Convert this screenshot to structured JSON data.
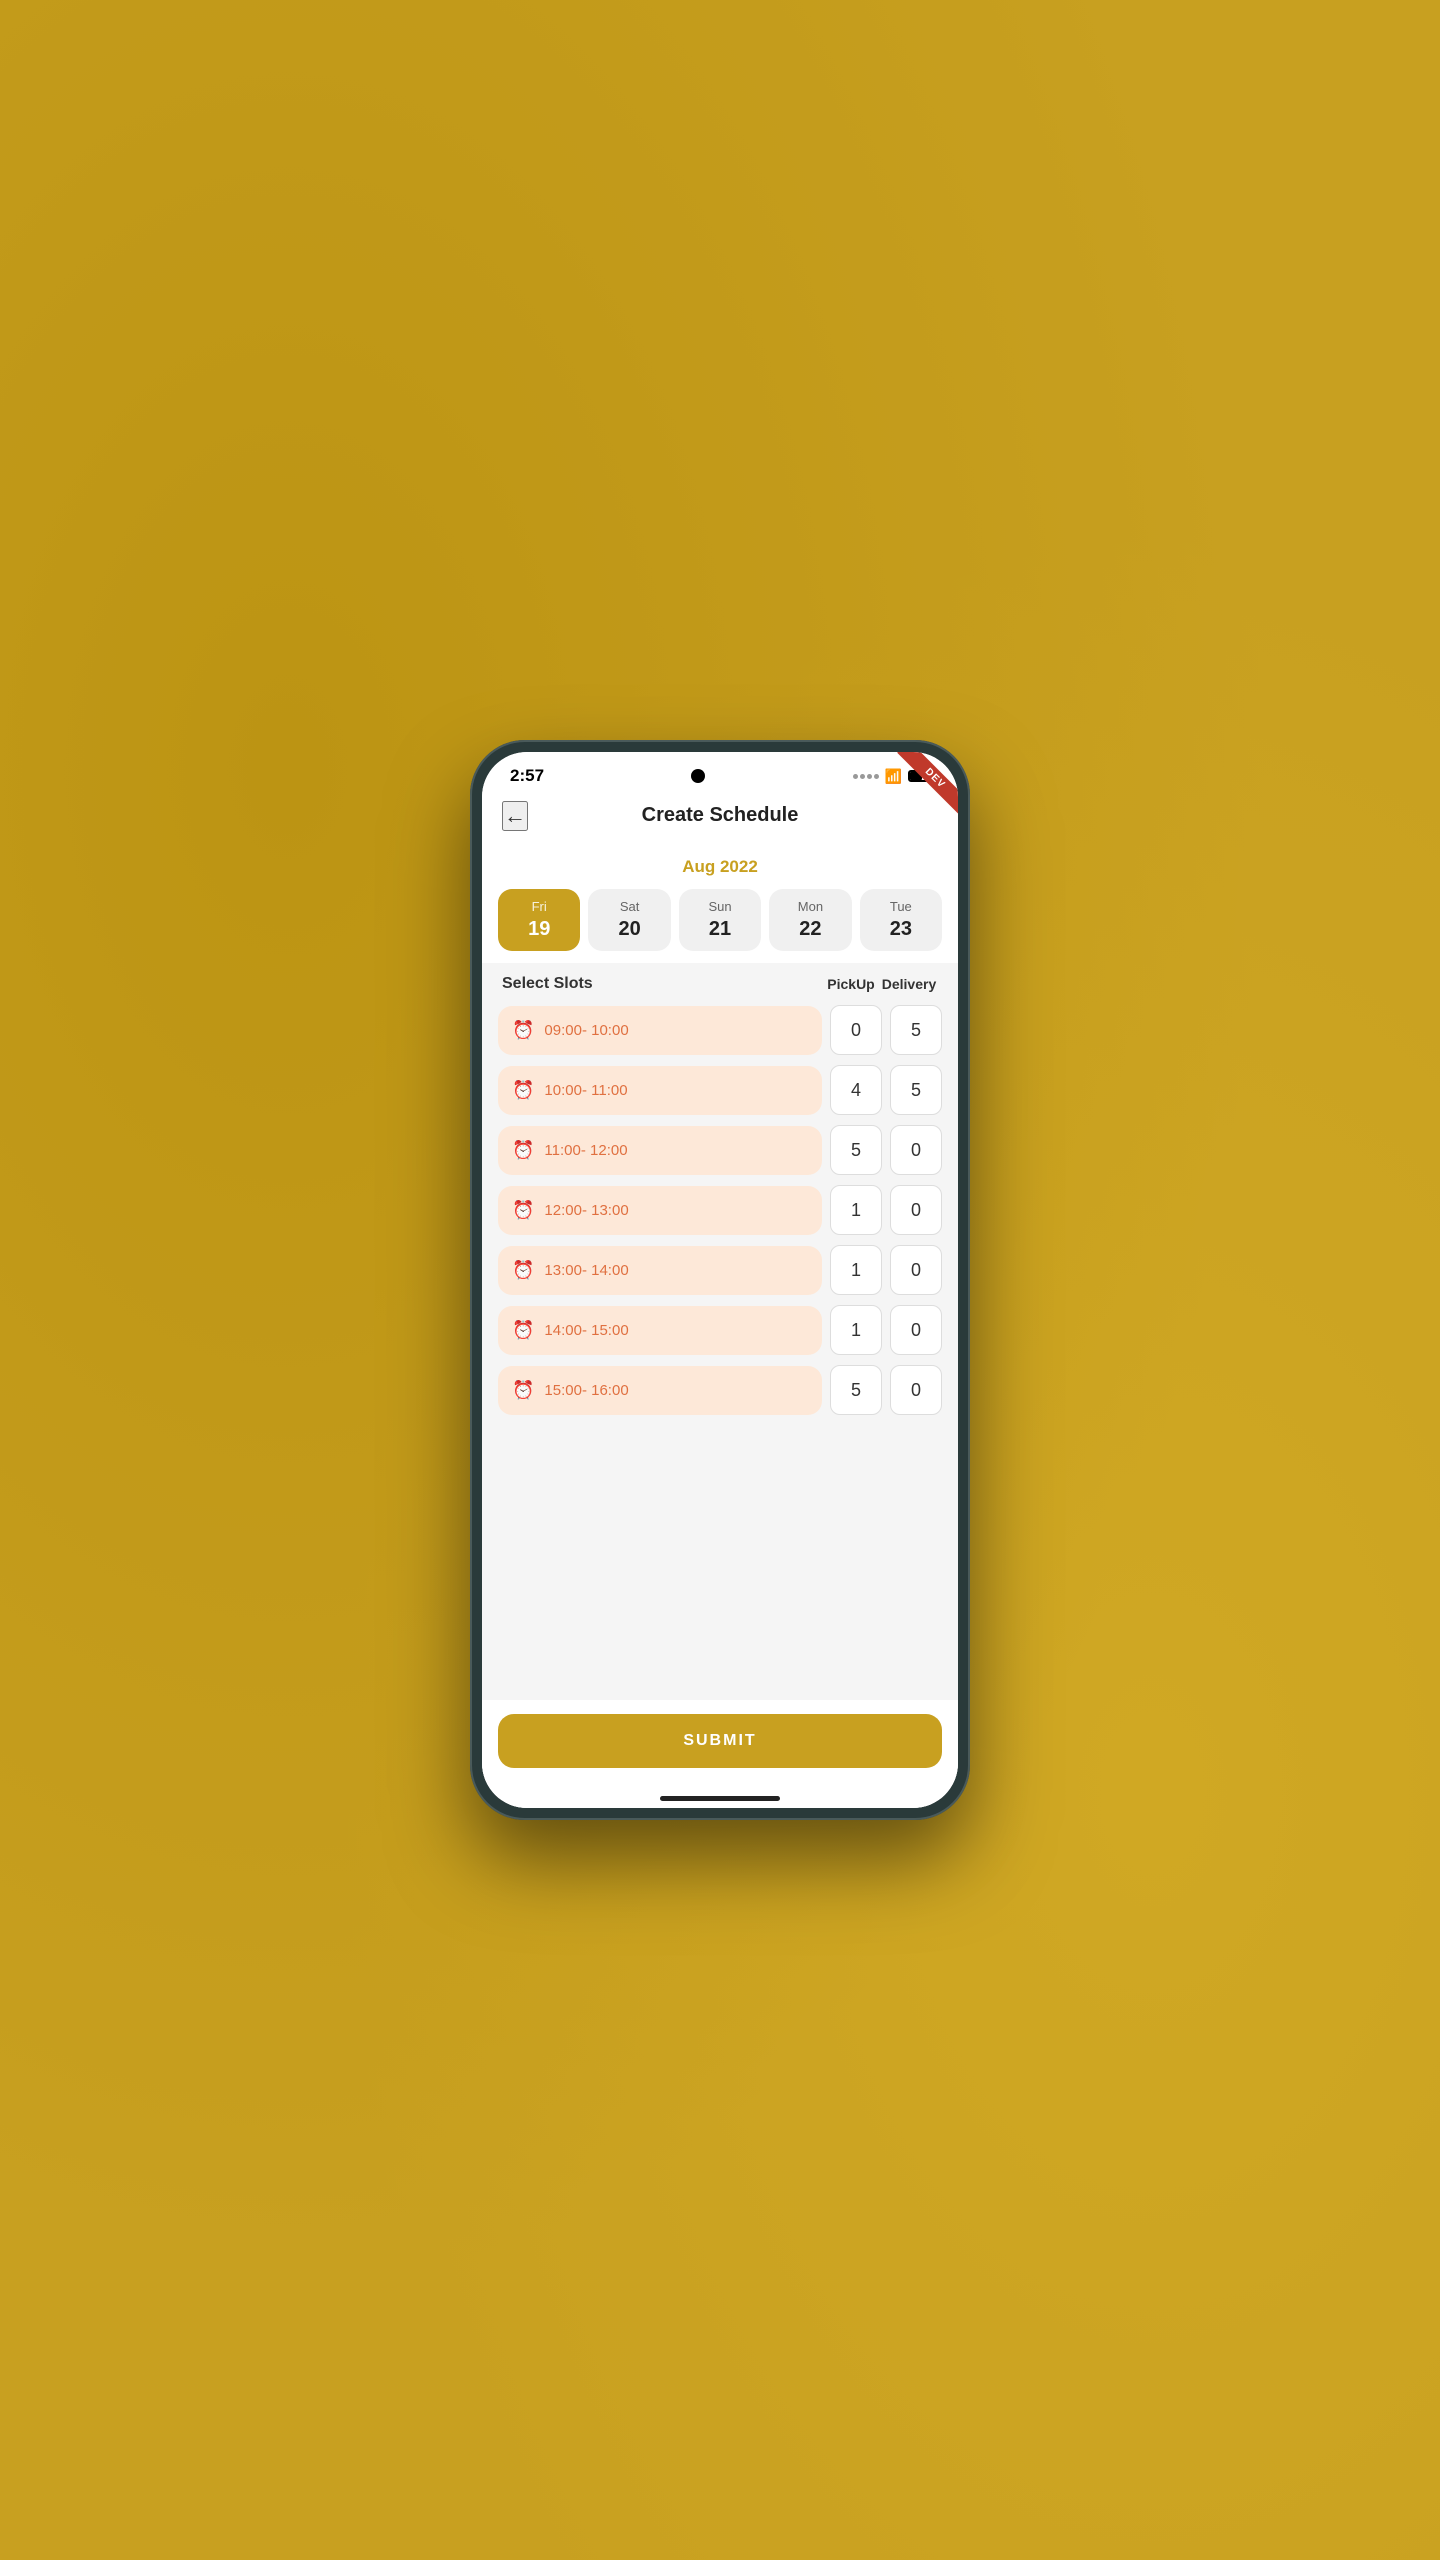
{
  "background": {
    "color": "#c8a020"
  },
  "status_bar": {
    "time": "2:57",
    "dev_badge": "DEV"
  },
  "header": {
    "back_label": "←",
    "title": "Create Schedule"
  },
  "calendar": {
    "month_label": "Aug 2022",
    "days": [
      {
        "name": "Fri",
        "number": "19",
        "active": true
      },
      {
        "name": "Sat",
        "number": "20",
        "active": false
      },
      {
        "name": "Sun",
        "number": "21",
        "active": false
      },
      {
        "name": "Mon",
        "number": "22",
        "active": false
      },
      {
        "name": "Tue",
        "number": "23",
        "active": false
      }
    ]
  },
  "slots": {
    "header_title": "Select Slots",
    "header_pickup": "PickUp",
    "header_delivery": "Delivery",
    "rows": [
      {
        "time": "09:00- 10:00",
        "pickup": "0",
        "delivery": "5"
      },
      {
        "time": "10:00- 11:00",
        "pickup": "4",
        "delivery": "5"
      },
      {
        "time": "11:00- 12:00",
        "pickup": "5",
        "delivery": "0"
      },
      {
        "time": "12:00- 13:00",
        "pickup": "1",
        "delivery": "0"
      },
      {
        "time": "13:00- 14:00",
        "pickup": "1",
        "delivery": "0"
      },
      {
        "time": "14:00- 15:00",
        "pickup": "1",
        "delivery": "0"
      },
      {
        "time": "15:00- 16:00",
        "pickup": "5",
        "delivery": "0"
      }
    ]
  },
  "submit": {
    "label": "SUBMIT"
  },
  "colors": {
    "accent": "#c8a020",
    "slot_bg": "#fde8d8",
    "clock_color": "#e07040"
  }
}
